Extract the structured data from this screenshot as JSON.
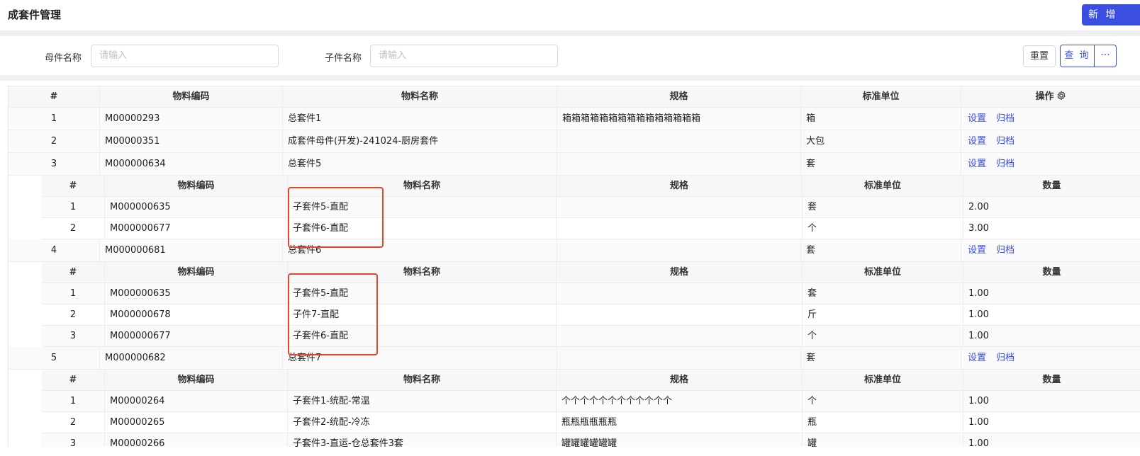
{
  "header": {
    "title": "成套件管理",
    "new_button": "新 增"
  },
  "search": {
    "parent_label": "母件名称",
    "parent_placeholder": "请输入",
    "child_label": "子件名称",
    "child_placeholder": "请输入",
    "reset": "重置",
    "query": "查 询",
    "more": "···"
  },
  "table": {
    "columns": [
      "#",
      "物料编码",
      "物料名称",
      "规格",
      "标准单位",
      "操作"
    ],
    "settings_icon": "gear-icon",
    "sub_columns": [
      "#",
      "物料编码",
      "物料名称",
      "规格",
      "标准单位",
      "数量"
    ],
    "action_set": "设置",
    "action_archive": "归档",
    "rows": [
      {
        "no": "1",
        "code": "M00000293",
        "name": "总套件1",
        "spec": "箱箱箱箱箱箱箱箱箱箱箱箱箱箱箱",
        "unit": "箱"
      },
      {
        "no": "2",
        "code": "M00000351",
        "name": "成套件母件(开发)-241024-厨房套件",
        "spec": "",
        "unit": "大包"
      },
      {
        "no": "3",
        "code": "M000000634",
        "name": "总套件5",
        "spec": "",
        "unit": "套",
        "children": [
          {
            "no": "1",
            "code": "M000000635",
            "name": "子套件5-直配",
            "spec": "",
            "unit": "套",
            "qty": "2.00"
          },
          {
            "no": "2",
            "code": "M000000677",
            "name": "子套件6-直配",
            "spec": "",
            "unit": "个",
            "qty": "3.00"
          }
        ]
      },
      {
        "no": "4",
        "code": "M000000681",
        "name": "总套件6",
        "spec": "",
        "unit": "套",
        "children": [
          {
            "no": "1",
            "code": "M000000635",
            "name": "子套件5-直配",
            "spec": "",
            "unit": "套",
            "qty": "1.00"
          },
          {
            "no": "2",
            "code": "M000000678",
            "name": "子件7-直配",
            "spec": "",
            "unit": "斤",
            "qty": "1.00"
          },
          {
            "no": "3",
            "code": "M000000677",
            "name": "子套件6-直配",
            "spec": "",
            "unit": "个",
            "qty": "1.00"
          }
        ]
      },
      {
        "no": "5",
        "code": "M000000682",
        "name": "总套件7",
        "spec": "",
        "unit": "套",
        "children": [
          {
            "no": "1",
            "code": "M00000264",
            "name": "子套件1-统配-常温",
            "spec": "个个个个个个个个个个个个",
            "unit": "个",
            "qty": "1.00"
          },
          {
            "no": "2",
            "code": "M00000265",
            "name": "子套件2-统配-冷冻",
            "spec": "瓶瓶瓶瓶瓶瓶",
            "unit": "瓶",
            "qty": "1.00"
          },
          {
            "no": "3",
            "code": "M00000266",
            "name": "子套件3-直运-仓总套件3套",
            "spec": "罐罐罐罐罐罐",
            "unit": "罐",
            "qty": "1.00"
          }
        ]
      }
    ]
  },
  "colors": {
    "accent": "#3a4fe0",
    "highlight": "#e5442d"
  }
}
